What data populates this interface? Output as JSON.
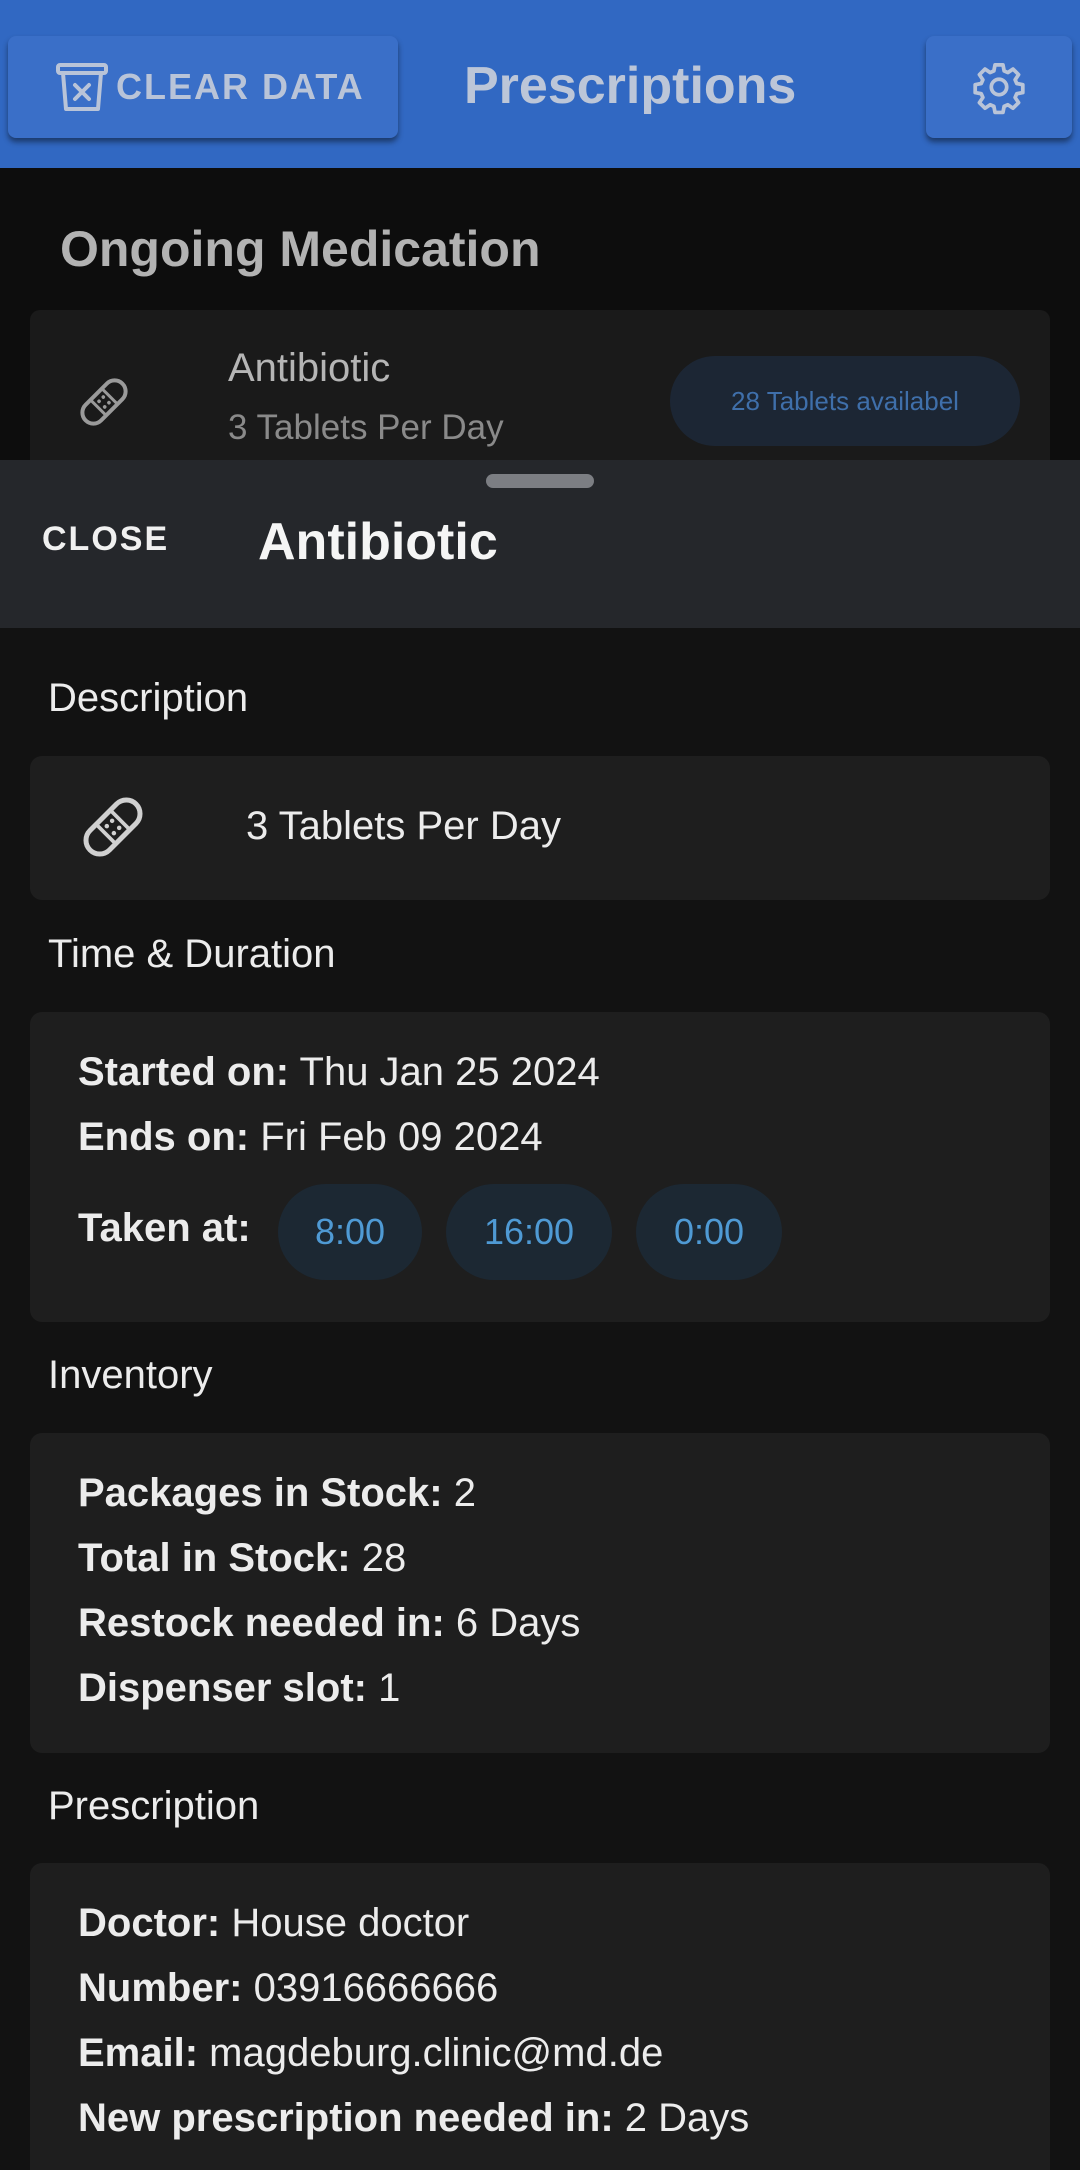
{
  "appbar": {
    "clear_label": "CLEAR DATA",
    "title": "Prescriptions",
    "icons": [
      "trash-icon",
      "gear-icon"
    ]
  },
  "background": {
    "section_title": "Ongoing Medication",
    "card": {
      "name": "Antibiotic",
      "dosage": "3 Tablets Per Day",
      "badge": "28 Tablets availabel"
    }
  },
  "sheet": {
    "close_label": "CLOSE",
    "title": "Antibiotic",
    "description": {
      "label": "Description",
      "text": "3 Tablets Per Day"
    },
    "time": {
      "label": "Time & Duration",
      "started_label": "Started on:",
      "started_value": "Thu Jan 25 2024",
      "ends_label": "Ends on:",
      "ends_value": "Fri Feb 09 2024",
      "taken_label": "Taken at:",
      "times": [
        "8:00",
        "16:00",
        "0:00"
      ]
    },
    "inventory": {
      "label": "Inventory",
      "packages_label": "Packages in Stock:",
      "packages_value": "2",
      "total_label": "Total in Stock:",
      "total_value": "28",
      "restock_label": "Restock needed in:",
      "restock_value": "6 Days",
      "slot_label": "Dispenser slot:",
      "slot_value": "1"
    },
    "prescription": {
      "label": "Prescription",
      "doctor_label": "Doctor:",
      "doctor_value": "House doctor",
      "number_label": "Number:",
      "number_value": "03916666666",
      "email_label": "Email:",
      "email_value": "magdeburg.clinic@md.de",
      "new_label": "New prescription needed in:",
      "new_value": "2 Days"
    }
  },
  "colors": {
    "appbar": "#3168c2",
    "chip_text": "#4f9ad4",
    "sheet_header": "#25272b"
  }
}
